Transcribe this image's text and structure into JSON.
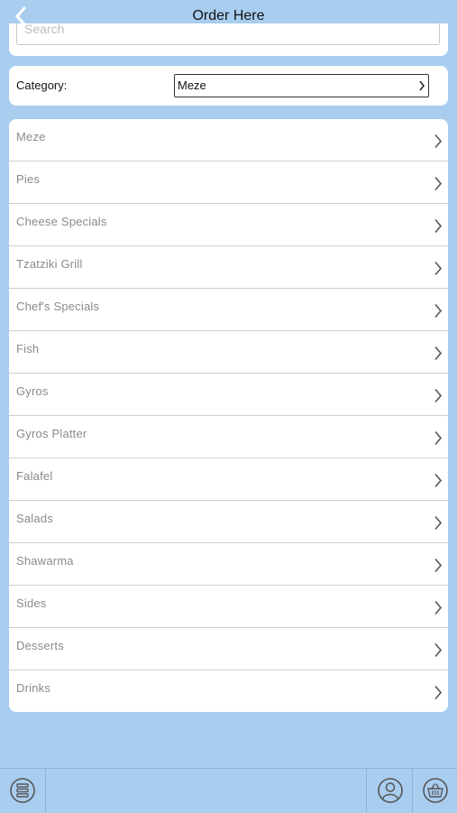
{
  "header": {
    "title": "Order Here",
    "back_icon": "chevron-left-icon"
  },
  "search": {
    "placeholder": "Search"
  },
  "category": {
    "label": "Category:",
    "selected": "Meze"
  },
  "menu": {
    "items": [
      {
        "label": "Meze"
      },
      {
        "label": "Pies"
      },
      {
        "label": "Cheese Specials"
      },
      {
        "label": "Tzatziki Grill"
      },
      {
        "label": "Chef's Specials"
      },
      {
        "label": "Fish"
      },
      {
        "label": "Gyros"
      },
      {
        "label": "Gyros Platter"
      },
      {
        "label": "Falafel"
      },
      {
        "label": "Salads"
      },
      {
        "label": "Shawarma"
      },
      {
        "label": "Sides"
      },
      {
        "label": "Desserts"
      },
      {
        "label": "Drinks"
      }
    ]
  },
  "toolbar": {
    "icons": [
      "menu-list-icon",
      "user-account-icon",
      "basket-icon"
    ]
  },
  "colors": {
    "background": "#a9cdef",
    "card": "#ffffff",
    "item_text": "#8a8a8a",
    "icon": "#555555"
  }
}
